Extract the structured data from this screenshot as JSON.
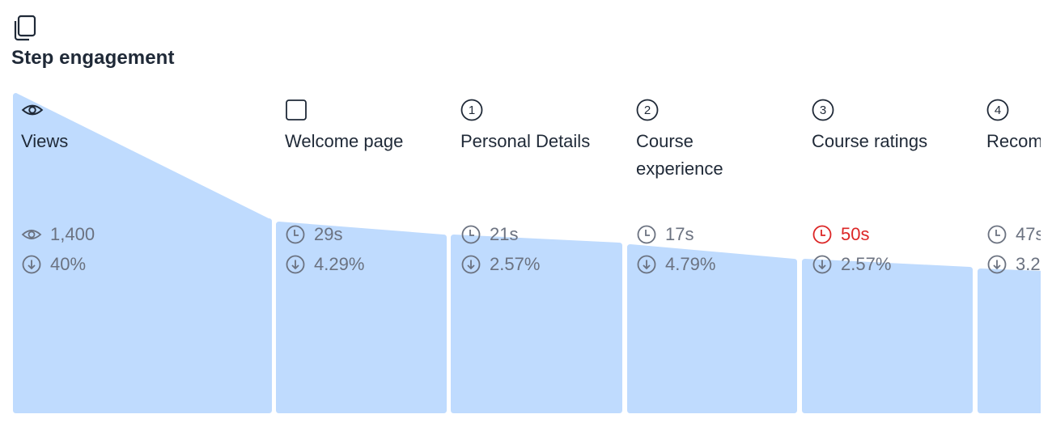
{
  "header": {
    "icon": "copy-icon",
    "title": "Step engagement"
  },
  "colors": {
    "fill": "#bfdbfe",
    "text": "#1f2937",
    "muted": "#6b7280",
    "alert": "#dc2626"
  },
  "steps": [
    {
      "icon": "eye-icon",
      "label": "Views",
      "stat1_icon": "eye-icon",
      "stat1": "1,400",
      "stat2": "40%",
      "alert": false
    },
    {
      "icon": "square-icon",
      "label": "Welcome page",
      "stat1_icon": "clock-icon",
      "stat1": "29s",
      "stat2": "4.29%",
      "alert": false
    },
    {
      "icon": "circled-number-icon",
      "number": "1",
      "label": "Personal Details",
      "stat1_icon": "clock-icon",
      "stat1": "21s",
      "stat2": "2.57%",
      "alert": false
    },
    {
      "icon": "circled-number-icon",
      "number": "2",
      "label": "Course experience",
      "stat1_icon": "clock-icon",
      "stat1": "17s",
      "stat2": "4.79%",
      "alert": false
    },
    {
      "icon": "circled-number-icon",
      "number": "3",
      "label": "Course ratings",
      "stat1_icon": "clock-icon",
      "stat1": "50s",
      "stat2": "2.57%",
      "alert": true
    },
    {
      "icon": "circled-number-icon",
      "number": "4",
      "label": "Recom",
      "stat1_icon": "clock-icon",
      "stat1": "47s",
      "stat2": "3.2",
      "alert": false
    }
  ]
}
